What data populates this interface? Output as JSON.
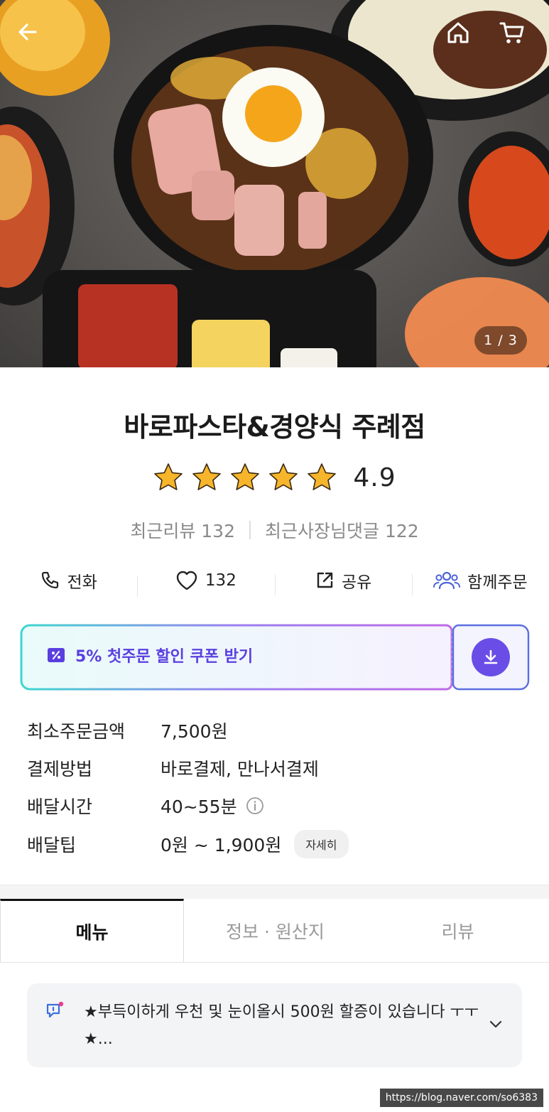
{
  "hero": {
    "counter": "1 / 3"
  },
  "store": {
    "name": "바로파스타&경양식 주례점",
    "rating": "4.9",
    "rating_value": 4.9,
    "recent_reviews": "최근리뷰 132",
    "owner_replies": "최근사장님댓글 122"
  },
  "actions": {
    "call": "전화",
    "like_count": "132",
    "share": "공유",
    "group_order": "함께주문"
  },
  "coupon": {
    "label": "5% 첫주문 할인 쿠폰 받기"
  },
  "info": {
    "min_order_label": "최소주문금액",
    "min_order_value": "7,500원",
    "payment_label": "결제방법",
    "payment_value": "바로결제, 만나서결제",
    "delivery_time_label": "배달시간",
    "delivery_time_value": "40~55분",
    "delivery_tip_label": "배달팁",
    "delivery_tip_value": "0원 ~ 1,900원",
    "detail_button": "자세히"
  },
  "tabs": {
    "menu": "메뉴",
    "info_origin": "정보 · 원산지",
    "reviews": "리뷰"
  },
  "notice": {
    "text": "★부득이하게 우천 및 눈이올시 500원 할증이 있습니다 ㅜㅜ★..."
  },
  "watermark": "https://blog.naver.com/so6383",
  "colors": {
    "accent": "#6a4de7",
    "star": "#f7b52c",
    "coupon_gradient_start": "#3ed6d0",
    "coupon_gradient_end": "#8b5cf6"
  }
}
